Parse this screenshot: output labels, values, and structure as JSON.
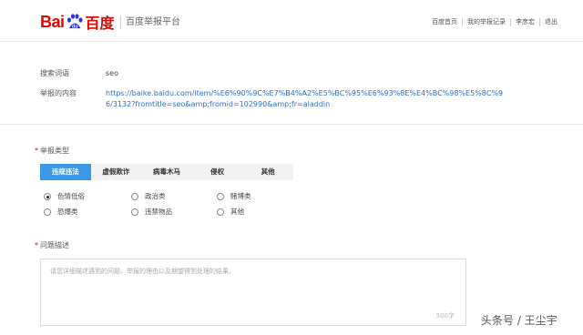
{
  "header": {
    "logo_text_left": "Bai",
    "logo_text_du": "du",
    "logo_text_cn": "百度",
    "subtitle": "百度举报平台",
    "nav": [
      "百度首页",
      "我的举报记录",
      "李彦宏",
      "退出"
    ]
  },
  "form": {
    "search_term_label": "搜索词语",
    "search_term_value": "seo",
    "content_label": "举报的内容",
    "content_url": "https://baike.baidu.com/item/%E6%90%9C%E7%B4%A2%E5%BC%95%E6%93%8E%E4%BC%98%E5%8C%96/3132?fromtitle=seo&amp;fromid=102990&amp;fr=aladdin",
    "required_mark": "*",
    "type_label": "举报类型",
    "tabs": [
      {
        "label": "违规违法",
        "active": true
      },
      {
        "label": "虚假欺诈",
        "active": false
      },
      {
        "label": "病毒木马",
        "active": false
      },
      {
        "label": "侵权",
        "active": false
      },
      {
        "label": "其他",
        "active": false
      }
    ],
    "radios": [
      {
        "label": "色情低俗",
        "checked": true
      },
      {
        "label": "政治类",
        "checked": false
      },
      {
        "label": "赌博类",
        "checked": false
      },
      {
        "label": "恐爆类",
        "checked": false
      },
      {
        "label": "违禁物品",
        "checked": false
      },
      {
        "label": "其他",
        "checked": false
      }
    ],
    "desc_label": "问题描述",
    "desc_placeholder": "请您详细描述遇到的问题、举报的理由以及期望得到处理的结果。",
    "desc_count": "500字"
  },
  "watermark": "头条号 / 王尘宇",
  "colors": {
    "brand_red": "#e10602",
    "tab_active": "#3b97e8",
    "link": "#2e6fc7"
  }
}
